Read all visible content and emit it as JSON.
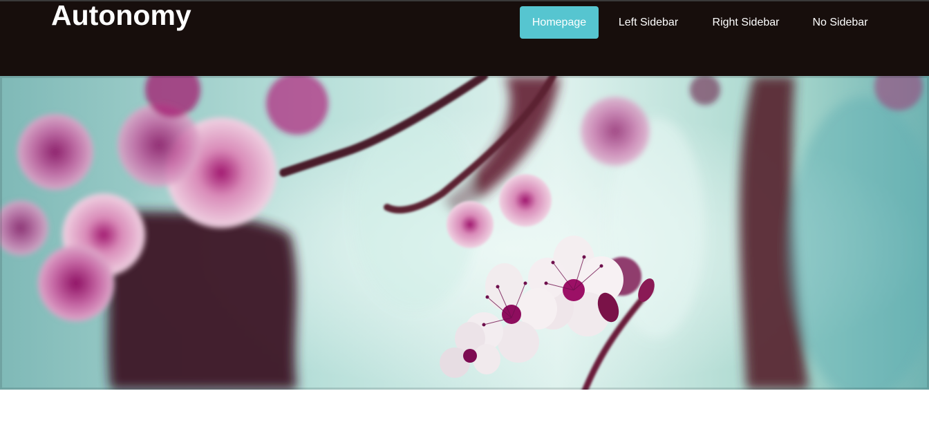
{
  "site": {
    "title": "Autonomy"
  },
  "nav": {
    "items": [
      {
        "label": "Homepage",
        "active": true
      },
      {
        "label": "Left Sidebar",
        "active": false
      },
      {
        "label": "Right Sidebar",
        "active": false
      },
      {
        "label": "No Sidebar",
        "active": false
      }
    ]
  },
  "colors": {
    "header_bg": "#170e0c",
    "accent": "#56c5d0",
    "text": "#ffffff"
  },
  "hero": {
    "image": "cherry-blossom-photo"
  }
}
